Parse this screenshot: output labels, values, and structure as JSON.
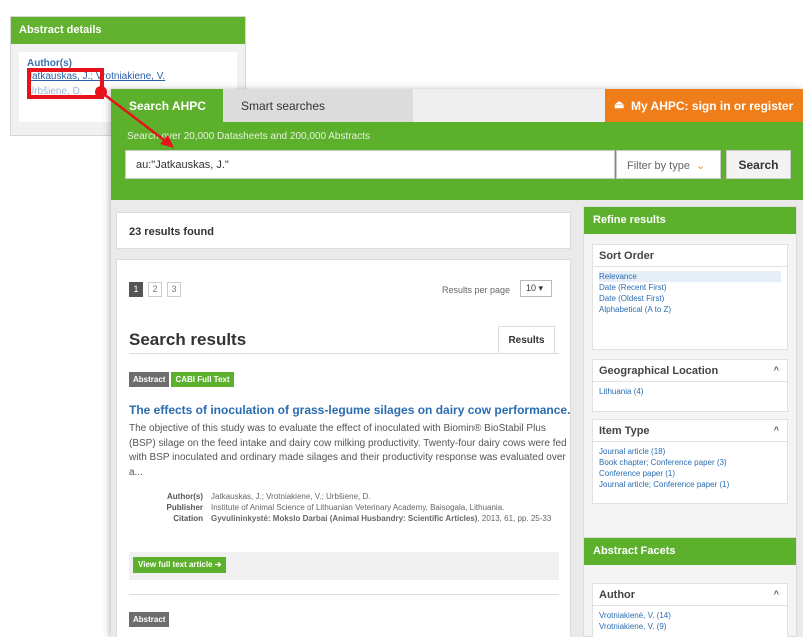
{
  "abstract_card": {
    "title": "Abstract details",
    "author_label": "Author(s)",
    "authors_line": "Jatkauskas, J.; Vrotniakiene, V.",
    "authors_line2": "Urbšiene, D."
  },
  "tabs": {
    "search": "Search AHPC",
    "smart": "Smart searches",
    "account": "My AHPC: sign in or register"
  },
  "search": {
    "tagline": "Search over 20,000 Datasheets and 200,000 Abstracts",
    "query": "au:\"Jatkauskas, J.\"",
    "filter_label": "Filter by type",
    "button": "Search"
  },
  "results": {
    "count_text": "23 results found",
    "pages": [
      "1",
      "2",
      "3"
    ],
    "per_page_label": "Results per page",
    "per_page_value": "10 ▾",
    "heading": "Search results",
    "tab": "Results",
    "items": [
      {
        "badges": [
          "Abstract",
          "CABI Full Text"
        ],
        "title": "The effects of inoculation of grass-legume silages on dairy cow performance.",
        "abstract": "The objective of this study was to evaluate the effect of inoculated with Biomin® BioStabil Plus (BSP) silage on the feed intake and dairy cow milking productivity. Twenty-four dairy cows were fed with BSP inoculated and ordinary made silages and their productivity response was evaluated over a...",
        "authors_label": "Author(s)",
        "authors": "Jatkauskas, J.; Vrotniakiene, V.; Urbšiene, D.",
        "publisher_label": "Publisher",
        "publisher": "Institute of Animal Science of Lithuanian Veterinary Academy, Baisogala, Lithuania.",
        "citation_label": "Citation",
        "citation_journal": "Gyvulininkystė: Mokslo Darbai (Animal Husbandry: Scientific Articles)",
        "citation_rest": ", 2013, 61, pp. 25-33",
        "view_button": "View full text article ➔"
      },
      {
        "badges": [
          "Abstract"
        ]
      }
    ]
  },
  "sidebar": {
    "refine_title": "Refine results",
    "sort_order": {
      "title": "Sort Order",
      "options": [
        "Relevance",
        "Date (Recent First)",
        "Date (Oldest First)",
        "Alphabetical (A to Z)"
      ]
    },
    "geo": {
      "title": "Geographical Location",
      "options": [
        "Lithuania (4)"
      ]
    },
    "item_type": {
      "title": "Item Type",
      "options": [
        "Journal article (18)",
        "Book chapter; Conference paper (3)",
        "Conference paper (1)",
        "Journal article; Conference paper (1)"
      ]
    },
    "abstract_facets_title": "Abstract Facets",
    "author": {
      "title": "Author",
      "options": [
        "Vrotniakienė, V. (14)",
        "Vrotniakiene, V. (9)"
      ]
    }
  },
  "colors": {
    "brand_green": "#5cb02c",
    "account_orange": "#ef7d1a",
    "link_blue": "#2a6cb0",
    "annotation_red": "#e8121c"
  }
}
